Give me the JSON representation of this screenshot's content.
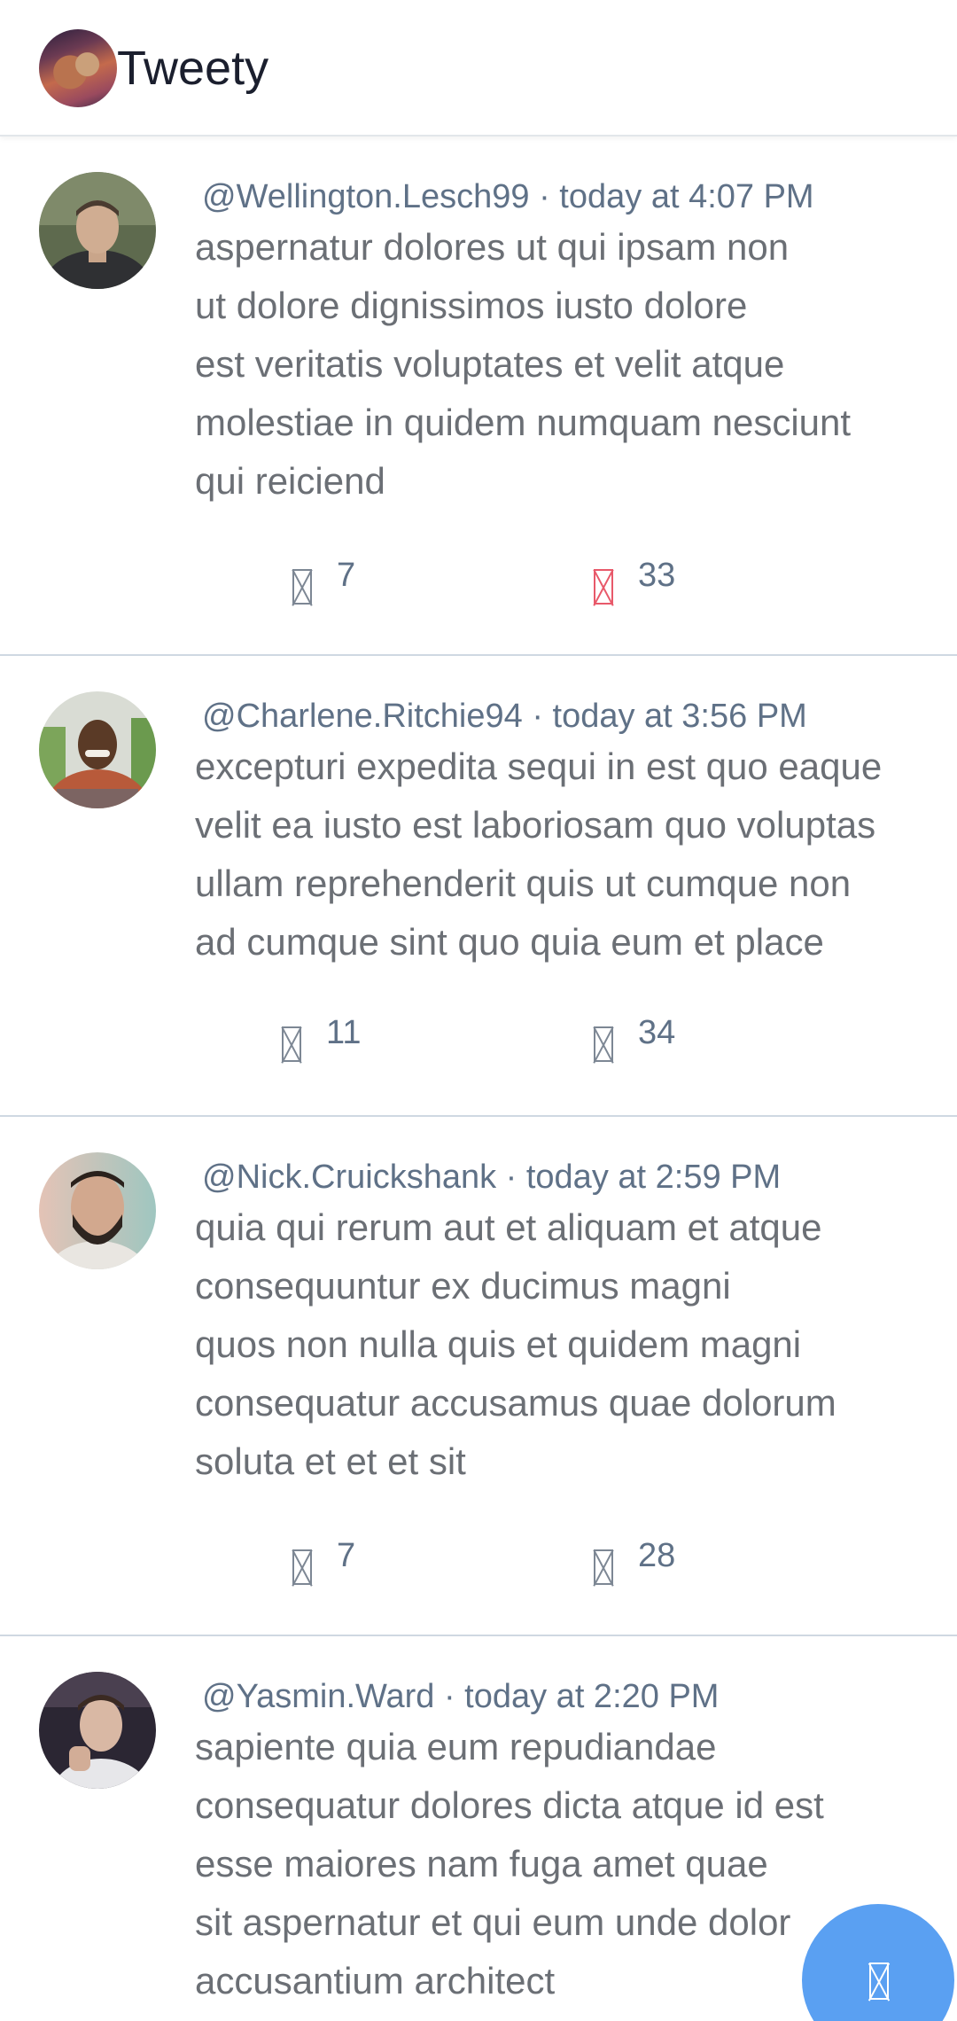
{
  "header": {
    "title": "Tweety"
  },
  "tweets": [
    {
      "meta": "@Wellington.Lesch99 · today at 4:07 PM",
      "body": "aspernatur dolores ut qui ipsam non\nut dolore dignissimos iusto dolore\nest veritatis voluptates et velit atque\nmolestiae in quidem numquam nesciunt\nqui reiciend",
      "replies": "7",
      "likes": "33",
      "liked": true
    },
    {
      "meta": "@Charlene.Ritchie94 · today at 3:56 PM",
      "body": "excepturi expedita sequi in est quo eaque\nvelit ea iusto est laboriosam quo voluptas\nullam reprehenderit quis ut cumque non\nad cumque sint quo quia eum et place",
      "replies": "11",
      "likes": "34",
      "liked": false
    },
    {
      "meta": "@Nick.Cruickshank · today at 2:59 PM",
      "body": "quia qui rerum aut et aliquam et atque\nconsequuntur ex ducimus magni\nquos non nulla quis et quidem magni\nconsequatur accusamus quae dolorum\nsoluta et et et sit",
      "replies": "7",
      "likes": "28",
      "liked": false
    },
    {
      "meta": "@Yasmin.Ward · today at 2:20 PM",
      "body": "sapiente quia eum repudiandae\nconsequatur dolores dicta atque id est\nesse maiores nam fuga amet quae\nsit aspernatur et qui eum unde dolor\naccusantium architect",
      "replies": "",
      "likes": "",
      "liked": false
    }
  ],
  "icons": {
    "reply": "reply-icon",
    "like": "heart-icon",
    "compose": "compose-icon"
  },
  "colors": {
    "accent": "#5aa0f2",
    "liked": "#e8596a",
    "meta": "#5f7187",
    "body": "#6b6f75"
  }
}
